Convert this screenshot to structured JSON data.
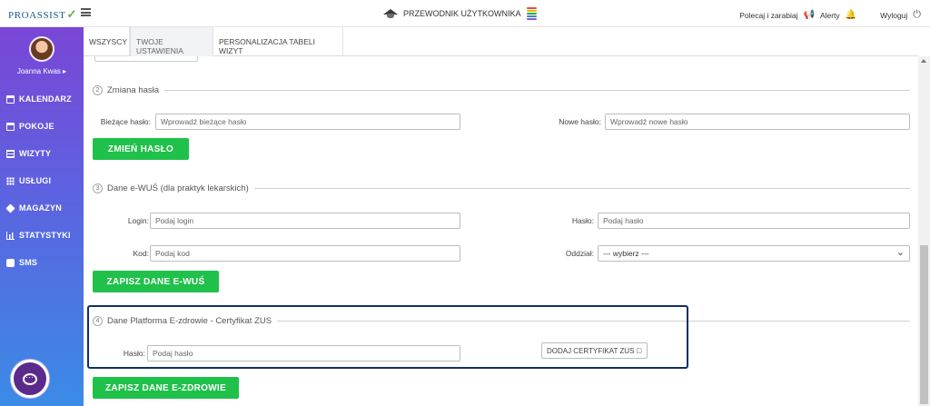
{
  "app": {
    "logo_text": "PROASSIST",
    "guide_label": "PRZEWODNIK UŻYTKOWNIKA",
    "refer_label": "Polecaj i zarabiaj",
    "alerts_label": "Alerty",
    "logout_label": "Wyloguj"
  },
  "sidebar": {
    "user_name": "Joanna Kwas ▸",
    "items": [
      {
        "label": "KALENDARZ",
        "icon": "calendar-icon"
      },
      {
        "label": "POKOJE",
        "icon": "calendar-icon"
      },
      {
        "label": "WIZYTY",
        "icon": "list-icon"
      },
      {
        "label": "USŁUGI",
        "icon": "grid-icon"
      },
      {
        "label": "MAGAZYN",
        "icon": "box-icon"
      },
      {
        "label": "STATYSTYKI",
        "icon": "bar-chart-icon"
      },
      {
        "label": "SMS",
        "icon": "sms-icon"
      }
    ]
  },
  "tabs": [
    "WSZYSCY",
    "TWOJE USTAWIENIA",
    "PERSONALIZACJA TABELI WIZYT"
  ],
  "sections": {
    "password": {
      "number": "2",
      "title": "Zmiana hasła",
      "current_label": "Bieżące hasło:",
      "current_placeholder": "Wprowadź bieżące hasło",
      "new_label": "Nowe hasło:",
      "new_placeholder": "Wprowadź nowe hasło",
      "button": "ZMIEŃ HASŁO"
    },
    "ewus": {
      "number": "3",
      "title": "Dane e-WUŚ (dla praktyk lekarskich)",
      "login_label": "Login:",
      "login_placeholder": "Podaj login",
      "password_label": "Hasło:",
      "password_placeholder": "Podaj hasło",
      "code_label": "Kod:",
      "code_placeholder": "Podaj kod",
      "branch_label": "Oddział:",
      "branch_value": "--- wybierz ---",
      "button": "ZAPISZ DANE E-WUŚ"
    },
    "ezdrowie": {
      "number": "4",
      "title": "Dane Platforma E-zdrowie - Certyfikat ZUS",
      "password_label": "Hasło:",
      "password_placeholder": "Podaj hasło",
      "cert_button": "DODAJ CERTYFIKAT ZUS",
      "button": "ZAPISZ DANE E-ZDROWIE"
    }
  },
  "colors": {
    "accent_green": "#20c14a",
    "sidebar_top": "#7a46d6",
    "sidebar_bottom": "#3b8be6",
    "highlight_border": "#0f2f66"
  }
}
